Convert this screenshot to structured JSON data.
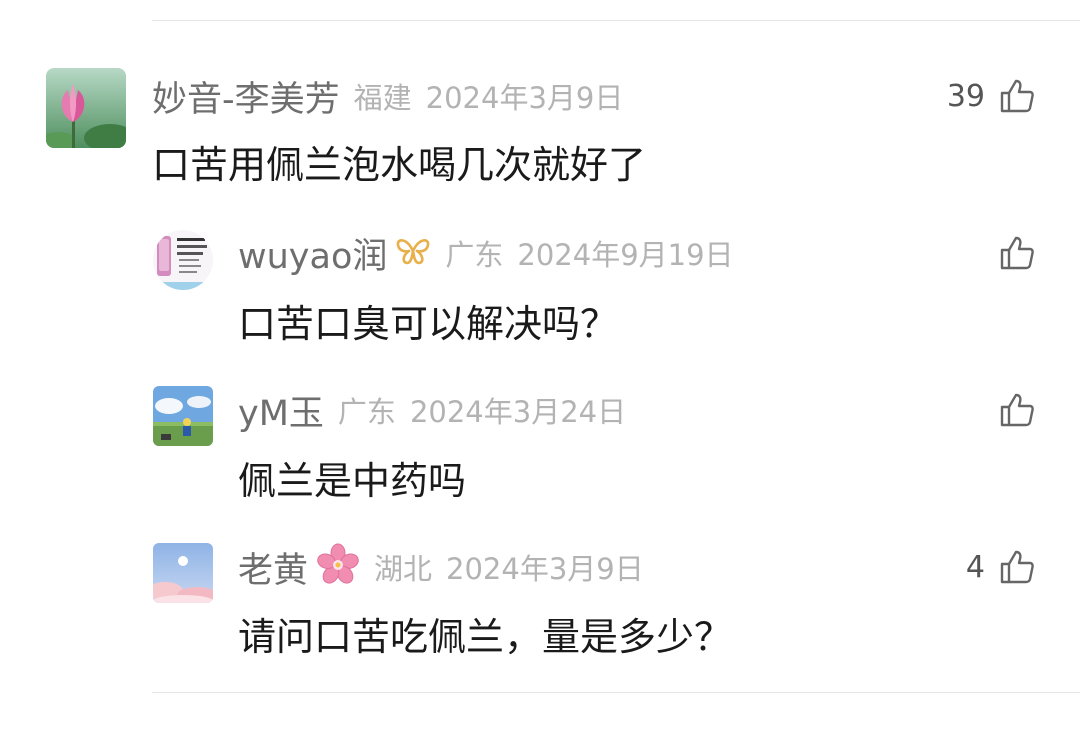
{
  "comments": [
    {
      "name": "妙音-李美芳",
      "region": "福建",
      "date": "2024年3月9日",
      "text": "口苦用佩兰泡水喝几次就好了",
      "likes": "39",
      "avatar": "lotus-avatar-image",
      "is_reply": false
    },
    {
      "name": "wuyao润",
      "badge": "butterfly-icon",
      "region": "广东",
      "date": "2024年9月19日",
      "text": "口苦口臭可以解决吗？",
      "likes": "",
      "avatar": "phone-ad-avatar-image",
      "is_reply": true
    },
    {
      "name": "yM玉",
      "region": "广东",
      "date": "2024年3月24日",
      "text": "佩兰是中药吗",
      "likes": "",
      "avatar": "sky-field-avatar-image",
      "is_reply": true
    },
    {
      "name": "老黄",
      "badge": "cherry-blossom-icon",
      "region": "湖北",
      "date": "2024年3月9日",
      "text": "请问口苦吃佩兰，量是多少？",
      "likes": "4",
      "avatar": "moon-sky-avatar-image",
      "is_reply": true
    }
  ],
  "icons": {
    "like": "thumbs-up-icon"
  },
  "colors": {
    "name": "#6e6e6e",
    "meta": "#b3b3b3",
    "content": "#1a1a1a",
    "butterfly": "#e8b04a",
    "blossom": "#f28db2"
  }
}
